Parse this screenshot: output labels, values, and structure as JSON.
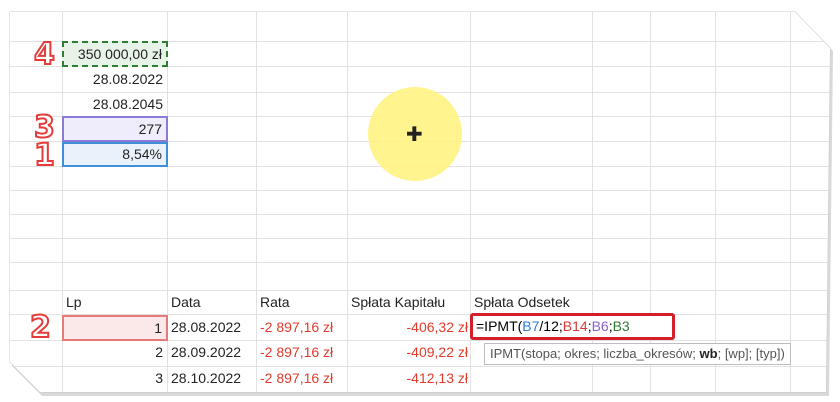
{
  "top_cells": {
    "amount": "350 000,00 zł",
    "start_date": "28.08.2022",
    "end_date": "28.08.2045",
    "periods": "277",
    "rate": "8,54%"
  },
  "markers": {
    "m4": "4",
    "m3": "3",
    "m1": "1",
    "m2": "2"
  },
  "table": {
    "headers": {
      "lp": "Lp",
      "data": "Data",
      "rata": "Rata",
      "kapital": "Spłata Kapitału",
      "odsetki": "Spłata Odsetek"
    },
    "rows": [
      {
        "lp": "1",
        "data": "28.08.2022",
        "rata": "-2 897,16 zł",
        "kapital": "-406,32 zł"
      },
      {
        "lp": "2",
        "data": "28.09.2022",
        "rata": "-2 897,16 zł",
        "kapital": "-409,22 zł"
      },
      {
        "lp": "3",
        "data": "28.10.2022",
        "rata": "-2 897,16 zł",
        "kapital": "-412,13 zł"
      }
    ]
  },
  "formula": {
    "prefix": "=IPMT(",
    "ref1": "B7",
    "part2": "/12;",
    "ref2": "B14",
    "sep1": ";",
    "ref3": "B6",
    "sep2": ";",
    "ref4": "B3"
  },
  "tooltip": {
    "pre": "IPMT(stopa; okres; liczba_okresów; ",
    "bold": "wb",
    "post": "; [wp]; [typ])"
  },
  "colors": {
    "marker": "#e53b3b",
    "formula_border": "#d31f2a",
    "ref_blue": "#2f7ccf",
    "ref_red": "#d23a3a",
    "ref_purple": "#8a63c9",
    "ref_green": "#2e7d32",
    "negative": "#e23b2b",
    "cursor_halo": "#fff27a"
  },
  "icons": {
    "cursor": "cell-select-cross-icon"
  }
}
